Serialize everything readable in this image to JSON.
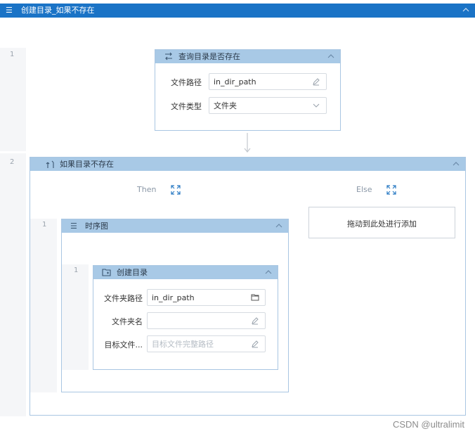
{
  "top_bar": {
    "title": "创建目录_如果不存在"
  },
  "rows": {
    "n1": "1",
    "n2": "2",
    "then_n1": "1",
    "seq_n1": "1"
  },
  "query_card": {
    "title": "查询目录是否存在",
    "fields": [
      {
        "label": "文件路径",
        "value": "in_dir_path",
        "icon": "edit-icon"
      },
      {
        "label": "文件类型",
        "value": "文件夹",
        "icon": "chevron-down-icon"
      }
    ]
  },
  "if_card": {
    "title": "如果目录不存在",
    "then_label": "Then",
    "else_label": "Else",
    "else_drop_text": "拖动到此处进行添加"
  },
  "seq_card": {
    "title": "时序图"
  },
  "create_card": {
    "title": "创建目录",
    "fields": [
      {
        "label": "文件夹路径",
        "value": "in_dir_path",
        "placeholder": "",
        "icon": "folder-icon"
      },
      {
        "label": "文件夹名",
        "value": "",
        "placeholder": "",
        "icon": "edit-icon"
      },
      {
        "label": "目标文件...",
        "value": "",
        "placeholder": "目标文件完整路径",
        "icon": "edit-icon"
      }
    ]
  },
  "watermark": "CSDN @ultralimit"
}
